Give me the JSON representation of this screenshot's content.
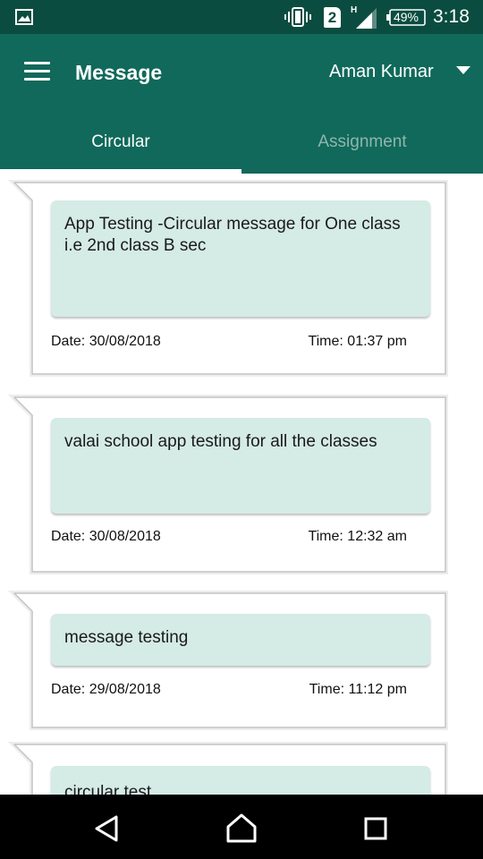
{
  "status_bar": {
    "icons": [
      "gallery-icon",
      "vibrate-icon",
      "sim-2-icon",
      "signal-icon",
      "battery-icon"
    ],
    "sim_slot": "2",
    "network_type": "H",
    "battery": "49%",
    "time": "3:18"
  },
  "app_bar": {
    "menu_icon": "hamburger-menu-icon",
    "title": "Message",
    "user_name": "Aman Kumar",
    "dropdown_icon": "caret-down-icon"
  },
  "tabs": [
    {
      "label": "Circular",
      "active": true
    },
    {
      "label": "Assignment",
      "active": false
    }
  ],
  "messages": [
    {
      "text": "App Testing -Circular message for One class i.e 2nd class B sec",
      "date": "Date: 30/08/2018",
      "time": "Time: 01:37 pm"
    },
    {
      "text": "valai school app testing for all the classes",
      "date": "Date: 30/08/2018",
      "time": "Time: 12:32 am"
    },
    {
      "text": "message testing",
      "date": "Date: 29/08/2018",
      "time": "Time: 11:12 pm"
    },
    {
      "text": "circular test",
      "date": "",
      "time": ""
    }
  ],
  "nav_bar": {
    "icons": [
      "back-icon",
      "home-icon",
      "recents-icon"
    ]
  },
  "colors": {
    "status_bar": "#0a4d40",
    "app_bar": "#10695a",
    "message_box": "#d5ebe5",
    "inactive_tab": "#8fb5ad"
  }
}
